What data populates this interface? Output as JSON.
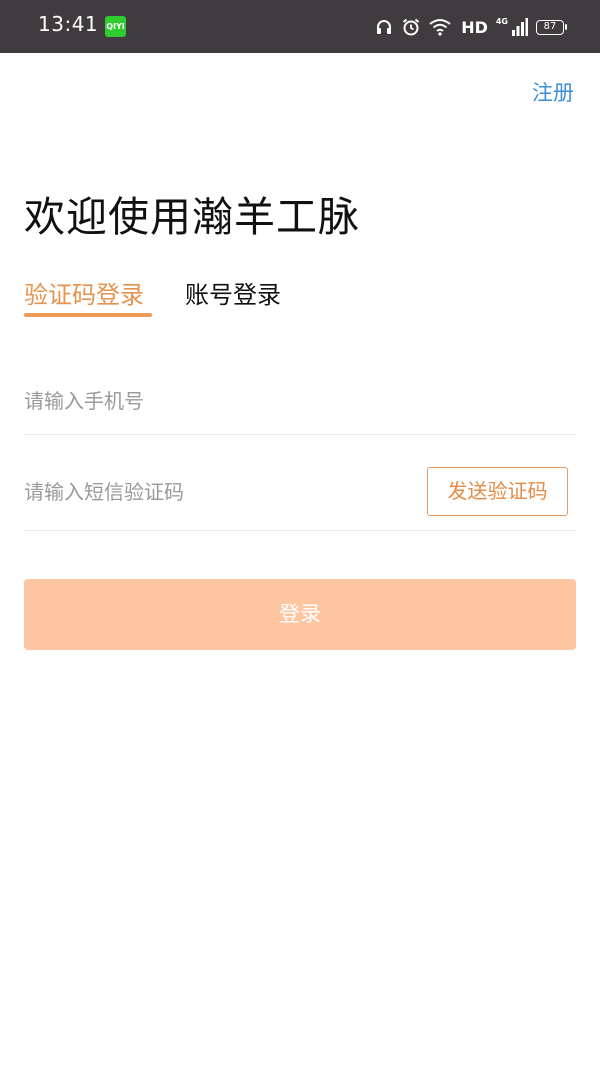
{
  "status_bar": {
    "time": "13:41",
    "app_badge": "QIYI",
    "network_type": "4G",
    "hd_label": "HD",
    "battery": "87"
  },
  "header": {
    "register_label": "注册"
  },
  "main": {
    "title": "欢迎使用瀚羊工脉",
    "tabs": [
      {
        "label": "验证码登录",
        "active": true
      },
      {
        "label": "账号登录",
        "active": false
      }
    ],
    "phone_input": {
      "placeholder": "请输入手机号",
      "value": ""
    },
    "code_input": {
      "placeholder": "请输入短信验证码",
      "value": ""
    },
    "send_code_label": "发送验证码",
    "login_label": "登录"
  },
  "colors": {
    "accent": "#e6934f",
    "link": "#3d8ed8",
    "login_button_bg": "#fec5a1",
    "status_bar_bg": "#3f3b3f"
  }
}
